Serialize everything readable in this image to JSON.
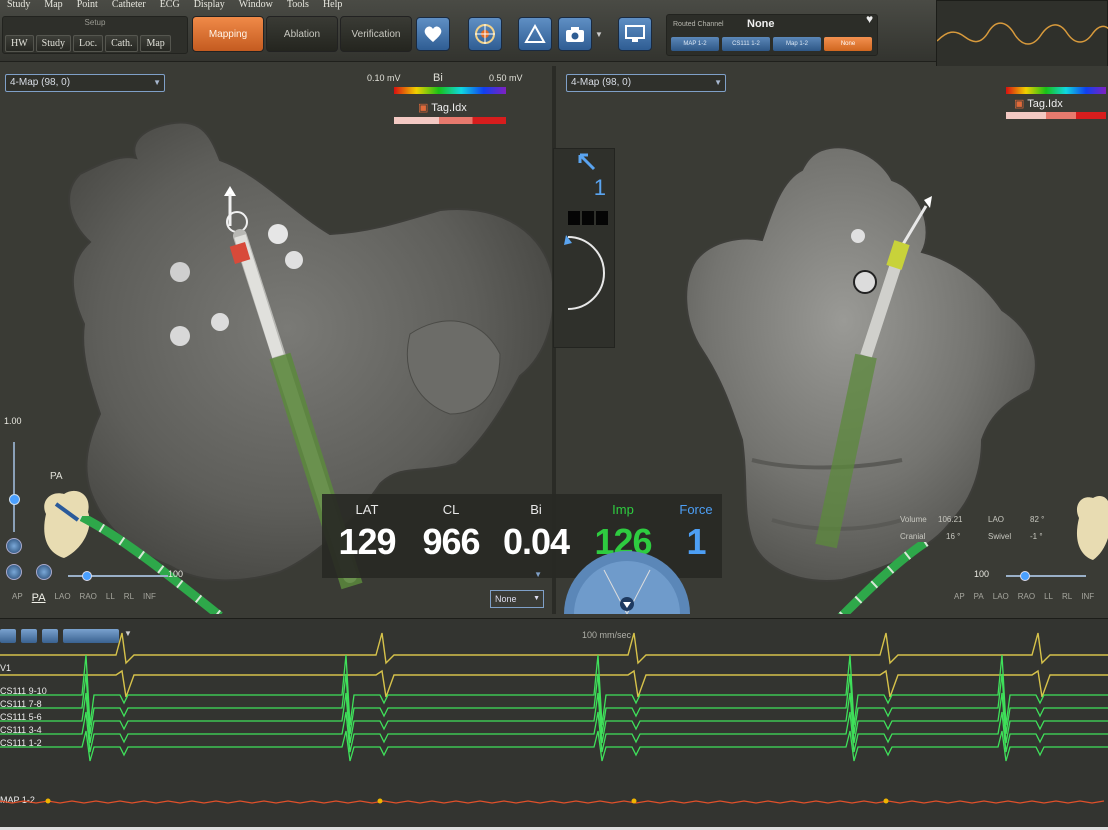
{
  "menu": [
    "Study",
    "Map",
    "Point",
    "Catheter",
    "ECG",
    "Display",
    "Window",
    "Tools",
    "Help"
  ],
  "setup": {
    "title": "Setup",
    "buttons": [
      "HW",
      "Study",
      "Loc.",
      "Cath.",
      "Map"
    ]
  },
  "modes": {
    "mapping": "Mapping",
    "ablation": "Ablation",
    "verification": "Verification"
  },
  "routed_channel": {
    "label": "Routed Channel",
    "value": "None",
    "buttons": [
      "MAP 1-2",
      "CS111 1-2",
      "Map 1-2",
      "None"
    ]
  },
  "left_view": {
    "map_select": "4-Map (98, 0)",
    "bi_min": "0.10 mV",
    "bi_label": "Bi",
    "bi_max": "0.50 mV",
    "tag_label": "Tag.Idx",
    "orientation_label": "PA",
    "zoom_scale": "1.00",
    "zoom_percent": "100",
    "views": [
      "AP",
      "PA",
      "LAO",
      "RAO",
      "LL",
      "RL",
      "INF"
    ],
    "active_view": "PA",
    "none_select": "None"
  },
  "right_view": {
    "map_select": "4-Map (98, 0)",
    "tag_label": "Tag.Idx",
    "zoom_percent": "100",
    "volume_label": "Volume",
    "volume_value": "106.21",
    "lao_label": "LAO",
    "lao_value": "82 °",
    "cranial_label": "Cranial",
    "cranial_value": "16 °",
    "swivel_label": "Swivel",
    "swivel_value": "-1 °",
    "views": [
      "AP",
      "PA",
      "LAO",
      "RAO",
      "LL",
      "RL",
      "INF"
    ]
  },
  "center_tools": {
    "value": "1"
  },
  "readout": {
    "lat_label": "LAT",
    "lat_value": "129",
    "cl_label": "CL",
    "cl_value": "966",
    "bi_label": "Bi",
    "bi_value": "0.04",
    "imp_label": "Imp",
    "imp_value": "126",
    "force_label": "Force",
    "force_value": "1"
  },
  "ecg": {
    "sweep": "100 mm/sec",
    "channels": [
      "V1",
      "CS111 9-10",
      "CS111 7-8",
      "CS111 5-6",
      "CS111 3-4",
      "CS111 1-2",
      "MAP 1-2"
    ]
  },
  "colors": {
    "accent": "#e9783a",
    "imp": "#2ecc40",
    "force": "#4d9ff5",
    "ecg_yellow": "#d6c24a",
    "ecg_green": "#3fe05a",
    "map_red": "#e0502a"
  }
}
